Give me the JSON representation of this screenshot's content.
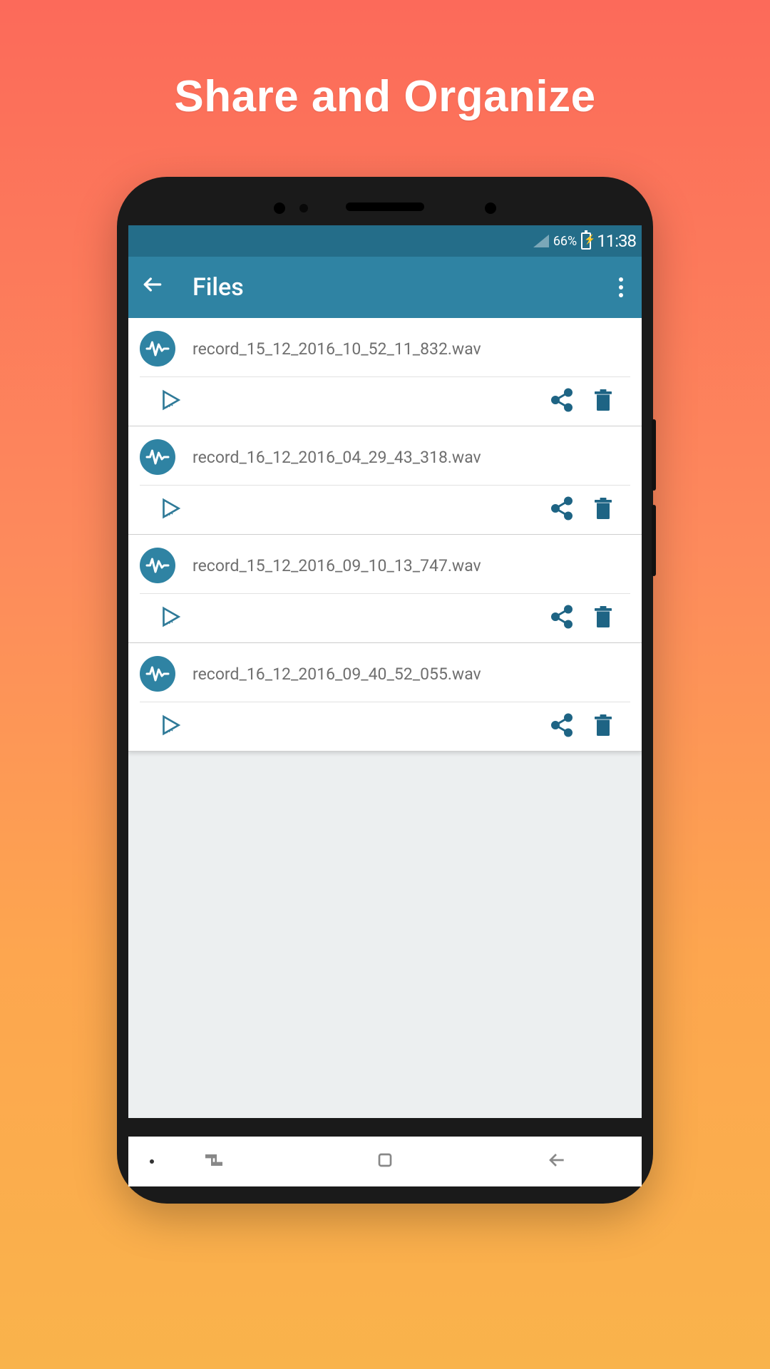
{
  "promo": {
    "title": "Share and Organize"
  },
  "status": {
    "battery_pct": "66%",
    "time": "11:38"
  },
  "appbar": {
    "title": "Files"
  },
  "files": [
    {
      "name": "record_15_12_2016_10_52_11_832.wav"
    },
    {
      "name": "record_16_12_2016_04_29_43_318.wav"
    },
    {
      "name": "record_15_12_2016_09_10_13_747.wav"
    },
    {
      "name": "record_16_12_2016_09_40_52_055.wav"
    }
  ],
  "colors": {
    "accent": "#2f83a3",
    "status": "#246d89",
    "text_muted": "#6f6f6f"
  }
}
